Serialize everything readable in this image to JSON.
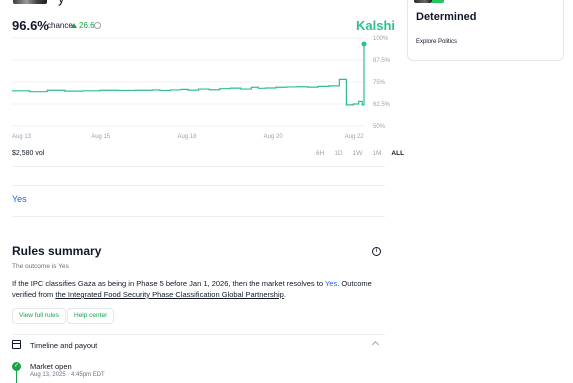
{
  "header": {
    "title_fragment": "y",
    "chance_value": "96.6%",
    "chance_label": "chance",
    "delta": "26.6",
    "brand": "Kalshi"
  },
  "chart_data": {
    "type": "line",
    "x_ticks": [
      "Aug 13",
      "Aug 15",
      "Aug 18",
      "Aug 20",
      "Aug 22"
    ],
    "y_ticks": [
      "100%",
      "87.5%",
      "75%",
      "62.5%",
      "50%"
    ],
    "ylim": [
      50,
      100
    ],
    "color": "#2fbf8f",
    "series": [
      {
        "x": [
          0,
          0.05,
          0.1,
          0.15,
          0.2,
          0.25,
          0.3,
          0.35,
          0.4,
          0.42,
          0.45,
          0.48,
          0.5,
          0.53,
          0.56,
          0.59,
          0.62,
          0.65,
          0.68,
          0.7,
          0.72,
          0.75,
          0.78,
          0.81,
          0.84,
          0.87,
          0.9,
          0.93,
          0.95,
          0.97,
          0.985,
          0.995,
          1.0
        ],
        "y": [
          70,
          69.5,
          70.3,
          69.8,
          70,
          70.3,
          70.2,
          70.3,
          70.5,
          70.2,
          70.5,
          70.8,
          70.4,
          71,
          70.6,
          71.2,
          71.5,
          71,
          72,
          71.4,
          71.6,
          72,
          72.2,
          72.3,
          72.1,
          72.5,
          72.8,
          76.5,
          62,
          62.5,
          64,
          62,
          96.6
        ]
      }
    ]
  },
  "volume": "$2,580 vol",
  "ranges": [
    "6H",
    "1D",
    "1W",
    "1M",
    "ALL"
  ],
  "ranges_active": "ALL",
  "outcome_tab": "Yes",
  "rules": {
    "title": "Rules summary",
    "outcome": "The outcome is Yes",
    "text_pre": "If the IPC classifies Gaza as being in Phase 5 before Jan 1, 2026, then the market resolves to",
    "text_yes": "Yes",
    "text_mid": ". Outcome verified from",
    "text_source": "the Integrated Food Security Phase Classification Global Partnership",
    "text_end": ".",
    "view_full": "View full rules",
    "help": "Help center"
  },
  "timeline": {
    "title": "Timeline and payout",
    "event": "Market open",
    "event_time": "Aug 13, 2025 · 4:45pm EDT"
  },
  "card": {
    "title": "Determined",
    "link": "Explore Politics"
  }
}
